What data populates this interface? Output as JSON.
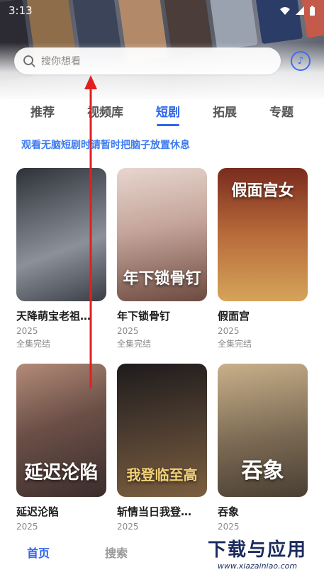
{
  "status_bar": {
    "time": "3:13"
  },
  "search": {
    "placeholder": "搜你想看"
  },
  "tabs": [
    {
      "label": "推荐",
      "active": false
    },
    {
      "label": "视频库",
      "active": false
    },
    {
      "label": "短剧",
      "active": true
    },
    {
      "label": "拓展",
      "active": false
    },
    {
      "label": "专题",
      "active": false
    }
  ],
  "notice": "观看无脑短剧时请暂时把脑子放置休息",
  "cards": [
    {
      "title": "天降萌宝老祖…",
      "year": "2025",
      "status": "全集完结",
      "cover_text": "",
      "color_a": "#2e3138",
      "color_b": "#8b9099"
    },
    {
      "title": "年下锁骨钉",
      "year": "2025",
      "status": "全集完结",
      "cover_text": "年下锁骨钉",
      "color_a": "#e7d6cf",
      "color_b": "#6d4a3f"
    },
    {
      "title": "假面宫",
      "year": "2025",
      "status": "全集完结",
      "cover_text": "假面宫女",
      "color_a": "#7a2b1e",
      "color_b": "#d5a45a"
    },
    {
      "title": "延迟沦陷",
      "year": "2025",
      "status": "",
      "cover_text": "延迟沦陷",
      "color_a": "#3b2d2c",
      "color_b": "#b48b78"
    },
    {
      "title": "斩情当日我登…",
      "year": "2025",
      "status": "",
      "cover_text": "我登临至高",
      "color_a": "#1e1b1c",
      "color_b": "#7b5e3f"
    },
    {
      "title": "吞象",
      "year": "2025",
      "status": "",
      "cover_text": "吞象",
      "color_a": "#7b6a54",
      "color_b": "#c9b08a"
    }
  ],
  "bottom_nav": [
    {
      "label": "首页",
      "active": true
    },
    {
      "label": "搜索",
      "active": false
    }
  ],
  "watermark": {
    "main": "下载与应用",
    "sub": "www.xiazainiao.com"
  },
  "colors": {
    "accent": "#2f66ea",
    "notice": "#3d7bf0",
    "arrow": "#e02020"
  }
}
